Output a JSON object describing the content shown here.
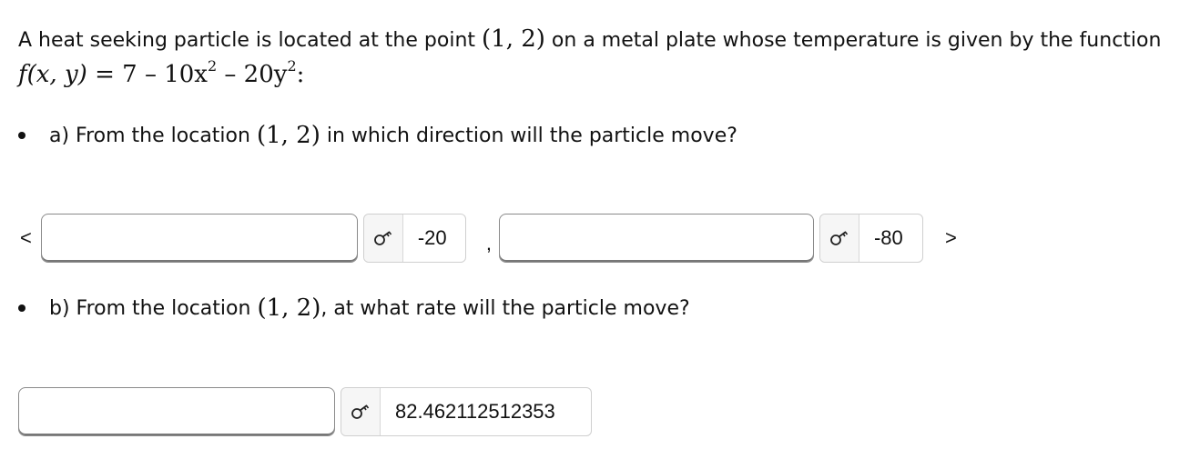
{
  "problem": {
    "intro": "A heat seeking particle is located at the point",
    "point": "(1, 2)",
    "middle": "on a metal plate whose temperature is given by the function",
    "function_lhs": "f(x, y)",
    "function_rhs_parts": [
      "7",
      "10x",
      "20y"
    ],
    "end_punct": ":"
  },
  "part_a": {
    "prefix": "a) From the location",
    "point": "(1, 2)",
    "suffix": "in which direction will the particle move?",
    "open_bracket": "<",
    "separator": ",",
    "close_bracket": ">",
    "inputs": [
      {
        "value": "",
        "result": "-20"
      },
      {
        "value": "",
        "result": "-80"
      }
    ]
  },
  "part_b": {
    "prefix": "b) From the location",
    "point": "(1, 2)",
    "suffix": ", at what rate will the particle move?",
    "input": {
      "value": "",
      "result": "82.462112512353"
    }
  },
  "icons": {
    "key": "key-icon"
  }
}
